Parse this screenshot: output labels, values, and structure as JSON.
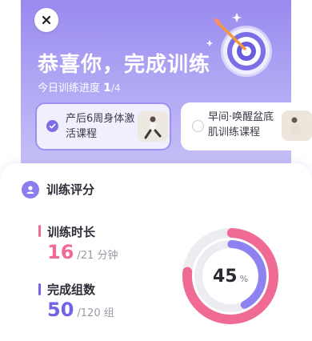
{
  "header": {
    "title": "恭喜你，完成训练",
    "progress_label": "今日训练进度",
    "progress_current": "1",
    "progress_total": "/4"
  },
  "icons": {
    "close": "close-icon",
    "target": "target-dart-icon",
    "check": "check-icon",
    "user": "user-icon"
  },
  "courses": [
    {
      "name": "产后6周身体激活课程",
      "selected": true
    },
    {
      "name": "早间·唤醒盆底肌训练课程",
      "selected": false
    }
  ],
  "score": {
    "title": "训练评分",
    "duration": {
      "label": "训练时长",
      "value": "16",
      "rest": "/21 分钟",
      "color": "#f06b94"
    },
    "sets": {
      "label": "完成组数",
      "value": "50",
      "rest": "/120 组",
      "color": "#7164e6"
    },
    "donut": {
      "percent_text": "45",
      "percent_sign": "%",
      "outer_fraction": 0.76,
      "inner_fraction": 0.42,
      "outer_color": "#f06b94",
      "inner_color": "#8e82f0",
      "track_color": "#ececf1"
    }
  },
  "colors": {
    "accent": "#8a7df0",
    "pink": "#f06b94"
  }
}
